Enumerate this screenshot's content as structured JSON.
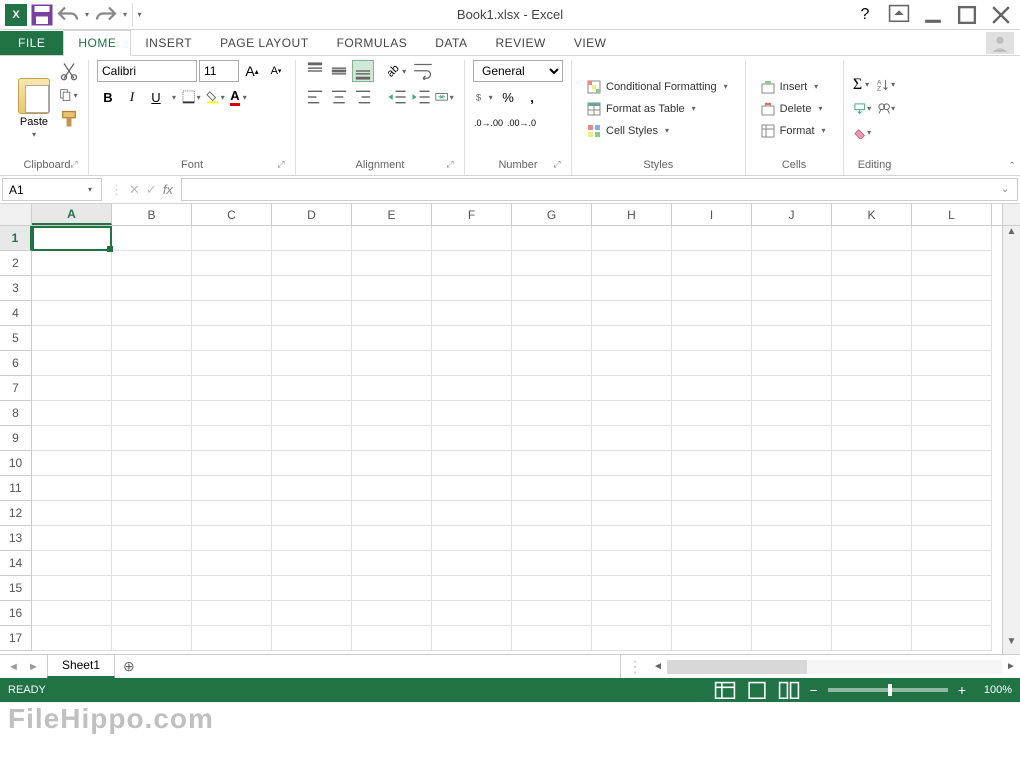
{
  "title": "Book1.xlsx - Excel",
  "tabs": {
    "file": "FILE",
    "list": [
      "HOME",
      "INSERT",
      "PAGE LAYOUT",
      "FORMULAS",
      "DATA",
      "REVIEW",
      "VIEW"
    ],
    "active": "HOME"
  },
  "ribbon": {
    "clipboard": {
      "paste": "Paste",
      "label": "Clipboard"
    },
    "font": {
      "name": "Calibri",
      "size": "11",
      "bold": "B",
      "italic": "I",
      "underline": "U",
      "grow": "A",
      "shrink": "A",
      "label": "Font"
    },
    "alignment": {
      "label": "Alignment"
    },
    "number": {
      "format": "General",
      "label": "Number"
    },
    "styles": {
      "conditional": "Conditional Formatting",
      "table": "Format as Table",
      "cell": "Cell Styles",
      "label": "Styles"
    },
    "cells": {
      "insert": "Insert",
      "delete": "Delete",
      "format": "Format",
      "label": "Cells"
    },
    "editing": {
      "label": "Editing"
    }
  },
  "formula": {
    "name_box": "A1",
    "fx": "fx"
  },
  "grid": {
    "columns": [
      "A",
      "B",
      "C",
      "D",
      "E",
      "F",
      "G",
      "H",
      "I",
      "J",
      "K",
      "L"
    ],
    "rows": [
      "1",
      "2",
      "3",
      "4",
      "5",
      "6",
      "7",
      "8",
      "9",
      "10",
      "11",
      "12",
      "13",
      "14",
      "15",
      "16",
      "17"
    ],
    "selected_col": "A",
    "selected_row": "1"
  },
  "sheets": {
    "active": "Sheet1"
  },
  "status": {
    "ready": "READY",
    "zoom": "100%"
  },
  "watermark": "FileHippo.com"
}
